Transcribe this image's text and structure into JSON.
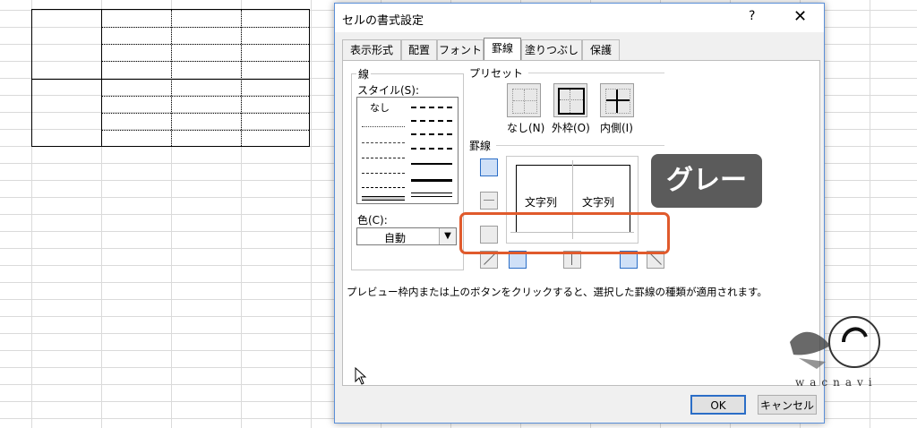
{
  "dialog": {
    "title": "セルの書式設定",
    "help": "?",
    "close": "✕",
    "tabs": [
      "表示形式",
      "配置",
      "フォント",
      "罫線",
      "塗りつぶし",
      "保護"
    ],
    "active_tab": "罫線"
  },
  "line_section": {
    "heading": "線",
    "style_label": "スタイル(S):",
    "none_label": "なし",
    "color_label": "色(C):",
    "color_value": "自動"
  },
  "preset_section": {
    "heading": "プリセット",
    "buttons": [
      "なし(N)",
      "外枠(O)",
      "内側(I)"
    ]
  },
  "border_section": {
    "heading": "罫線",
    "preview_text": [
      "文字列",
      "文字列"
    ]
  },
  "annotation": {
    "badge_text": "グレー",
    "accent": "#e05a2c"
  },
  "hint_text": "プレビュー枠内または上のボタンをクリックすると、選択した罫線の種類が適用されます。",
  "footer": {
    "ok": "OK",
    "cancel": "キャンセル"
  },
  "watermark": "wacnavi"
}
